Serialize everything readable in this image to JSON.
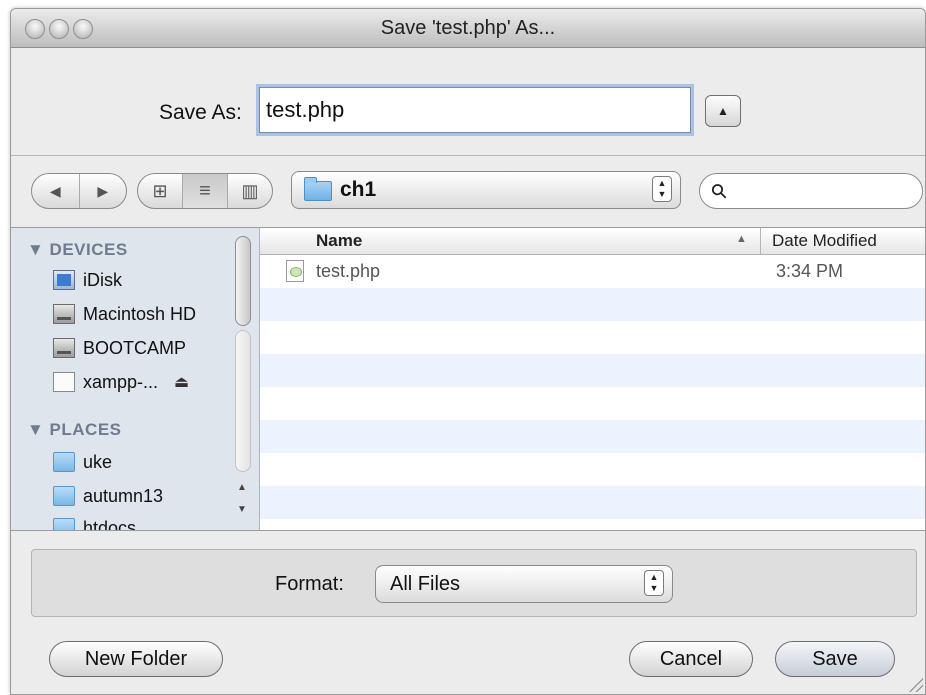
{
  "window": {
    "title": "Save 'test.php' As..."
  },
  "save_as": {
    "label": "Save As:",
    "value": "test.php",
    "expand_glyph": "▲"
  },
  "toolbar": {
    "nav_back_glyph": "◀",
    "nav_forward_glyph": "▶",
    "view_icon_glyph": "⊞",
    "view_list_glyph": "≡",
    "view_column_glyph": "▥",
    "location": "ch1",
    "search_glyph": "⚲",
    "search_value": ""
  },
  "sidebar": {
    "devices_heading": "▼ DEVICES",
    "devices": [
      {
        "label": "iDisk",
        "icon": "idisk-icon"
      },
      {
        "label": "Macintosh HD",
        "icon": "hard-drive-icon"
      },
      {
        "label": "BOOTCAMP",
        "icon": "hard-drive-icon"
      },
      {
        "label": "xampp-...",
        "icon": "volume-icon",
        "eject": "⏏"
      }
    ],
    "places_heading": "▼ PLACES",
    "places": [
      {
        "label": "uke",
        "icon": "folder-icon"
      },
      {
        "label": "autumn13",
        "icon": "folder-icon"
      },
      {
        "label": "htdocs",
        "icon": "folder-icon"
      }
    ]
  },
  "file_list": {
    "columns": {
      "name": "Name",
      "sort_glyph": "▲",
      "date": "Date Modified"
    },
    "rows": [
      {
        "name": "test.php",
        "date": "3:34 PM",
        "icon": "php-file-icon"
      }
    ]
  },
  "format": {
    "label": "Format:",
    "value": "All Files"
  },
  "buttons": {
    "new_folder": "New Folder",
    "cancel": "Cancel",
    "save": "Save"
  },
  "colors": {
    "sidebar_bg": "#dfe5ec",
    "stripe": "#edf3fe",
    "focus_ring": "#a9c3e6"
  }
}
